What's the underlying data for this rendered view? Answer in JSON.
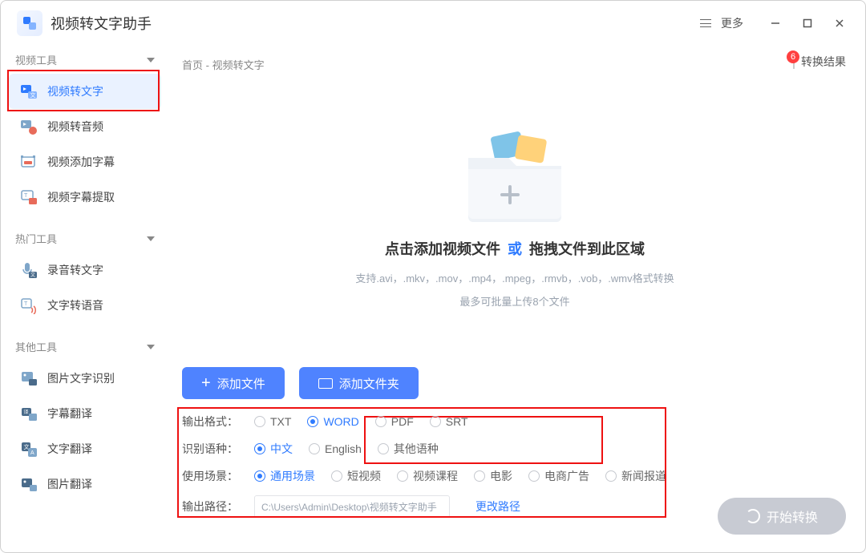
{
  "titlebar": {
    "app_title": "视频转文字助手",
    "more": "更多"
  },
  "sidebar": {
    "groups": [
      {
        "label": "视频工具",
        "items": [
          {
            "label": "视频转文字",
            "active": true
          },
          {
            "label": "视频转音频"
          },
          {
            "label": "视频添加字幕"
          },
          {
            "label": "视频字幕提取"
          }
        ]
      },
      {
        "label": "热门工具",
        "items": [
          {
            "label": "录音转文字"
          },
          {
            "label": "文字转语音"
          }
        ]
      },
      {
        "label": "其他工具",
        "items": [
          {
            "label": "图片文字识别"
          },
          {
            "label": "字幕翻译"
          },
          {
            "label": "文字翻译"
          },
          {
            "label": "图片翻译"
          }
        ]
      }
    ]
  },
  "breadcrumb": {
    "home": "首页",
    "current": "视频转文字"
  },
  "results": {
    "label": "转换结果",
    "badge": "6"
  },
  "drop": {
    "title_left": "点击添加视频文件",
    "or": "或",
    "title_right": "拖拽文件到此区域",
    "supports": "支持.avi，.mkv，.mov，.mp4，.mpeg，.rmvb，.vob，.wmv格式转换",
    "limit": "最多可批量上传8个文件",
    "add_file": "添加文件",
    "add_folder": "添加文件夹"
  },
  "settings": {
    "output_format": {
      "label": "输出格式：",
      "options": [
        "TXT",
        "WORD",
        "PDF",
        "SRT"
      ],
      "selected": "WORD"
    },
    "language": {
      "label": "识别语种：",
      "options": [
        "中文",
        "English",
        "其他语种"
      ],
      "selected": "中文"
    },
    "scene": {
      "label": "使用场景：",
      "options": [
        "通用场景",
        "短视频",
        "视频课程",
        "电影",
        "电商广告",
        "新闻报道"
      ],
      "selected": "通用场景"
    },
    "path": {
      "label": "输出路径：",
      "value": "C:\\Users\\Admin\\Desktop\\视频转文字助手",
      "change": "更改路径"
    }
  },
  "start": {
    "label": "开始转换"
  }
}
